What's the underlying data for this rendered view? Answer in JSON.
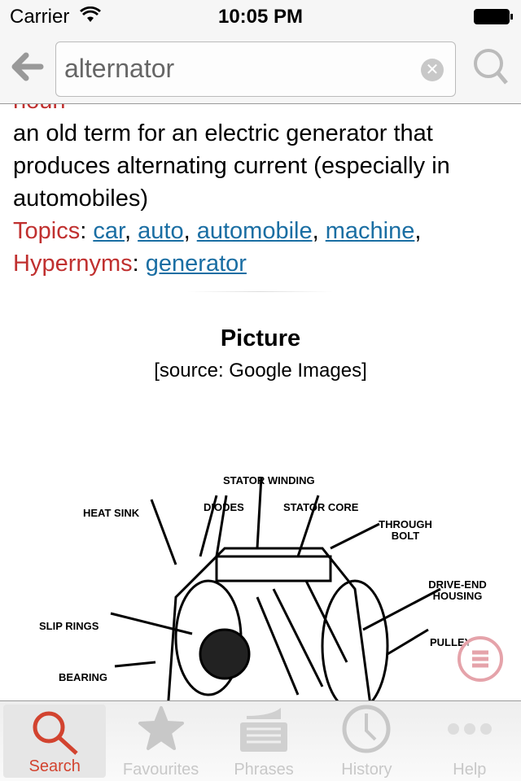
{
  "status": {
    "carrier": "Carrier",
    "time": "10:05 PM"
  },
  "search": {
    "value": "alternator"
  },
  "entry": {
    "pos": "noun",
    "definition": "an old term for an electric generator that produces alternating current (especially in automobiles)",
    "topics_label": "Topics",
    "topics": [
      "car",
      "auto",
      "automobile",
      "machine"
    ],
    "hypernyms_label": "Hypernyms",
    "hypernyms": [
      "generator"
    ]
  },
  "picture": {
    "title": "Picture",
    "source": "[source: Google Images]",
    "labels": [
      "STATOR WINDING",
      "HEAT SINK",
      "DIODES",
      "STATOR CORE",
      "THROUGH BOLT",
      "DRIVE-END HOUSING",
      "SLIP RINGS",
      "PULLEY",
      "BEARING"
    ]
  },
  "tabs": [
    {
      "label": "Search",
      "icon": "search-icon",
      "active": true
    },
    {
      "label": "Favourites",
      "icon": "star-icon"
    },
    {
      "label": "Phrases",
      "icon": "phrases-icon"
    },
    {
      "label": "History",
      "icon": "clock-icon"
    },
    {
      "label": "Help",
      "icon": "more-icon"
    }
  ],
  "colors": {
    "accent": "#d2432f",
    "link": "#1a6ea3",
    "label_red": "#c0302f"
  }
}
